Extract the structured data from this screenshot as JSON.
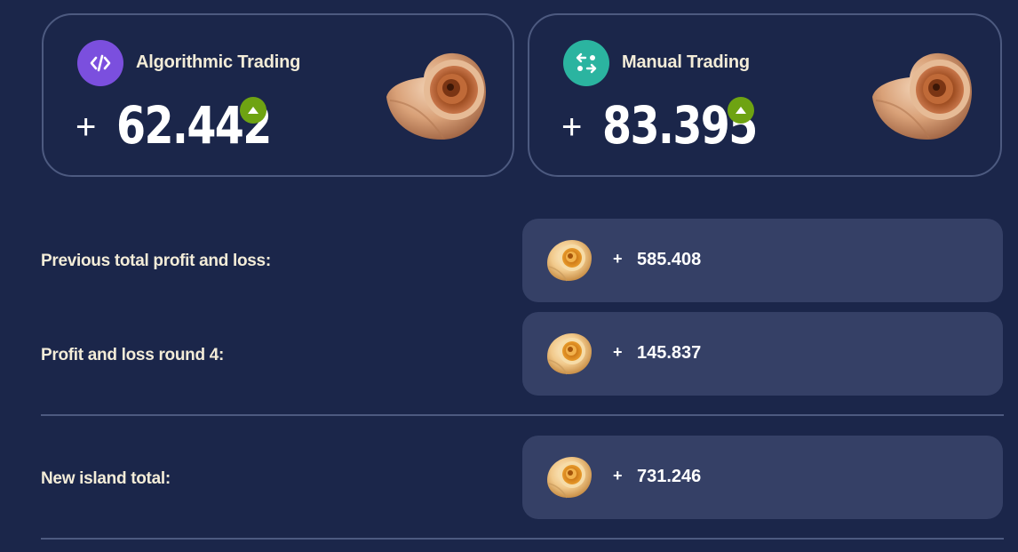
{
  "cards": {
    "algorithmic": {
      "title": "Algorithmic Trading",
      "sign": "+",
      "value": "62.442",
      "icon": "code-icon",
      "icon_color": "#7b4fde",
      "trend": "up"
    },
    "manual": {
      "title": "Manual Trading",
      "sign": "+",
      "value": "83.395",
      "icon": "exchange-arrows-icon",
      "icon_color": "#2bb4a0",
      "trend": "up"
    }
  },
  "rows": {
    "previous_total": {
      "label": "Previous total profit and loss:",
      "sign": "+",
      "value": "585.408",
      "icon": "shell-icon"
    },
    "round": {
      "label": "Profit and loss round 4:",
      "sign": "+",
      "value": "145.837",
      "icon": "shell-icon"
    },
    "island_total": {
      "label": "New island total:",
      "sign": "+",
      "value": "731.246",
      "icon": "shell-icon"
    }
  },
  "colors": {
    "background": "#1b264a",
    "panel": "#354066",
    "border": "#4d5a80",
    "up": "#6ea312",
    "text": "#f3ecd8"
  }
}
